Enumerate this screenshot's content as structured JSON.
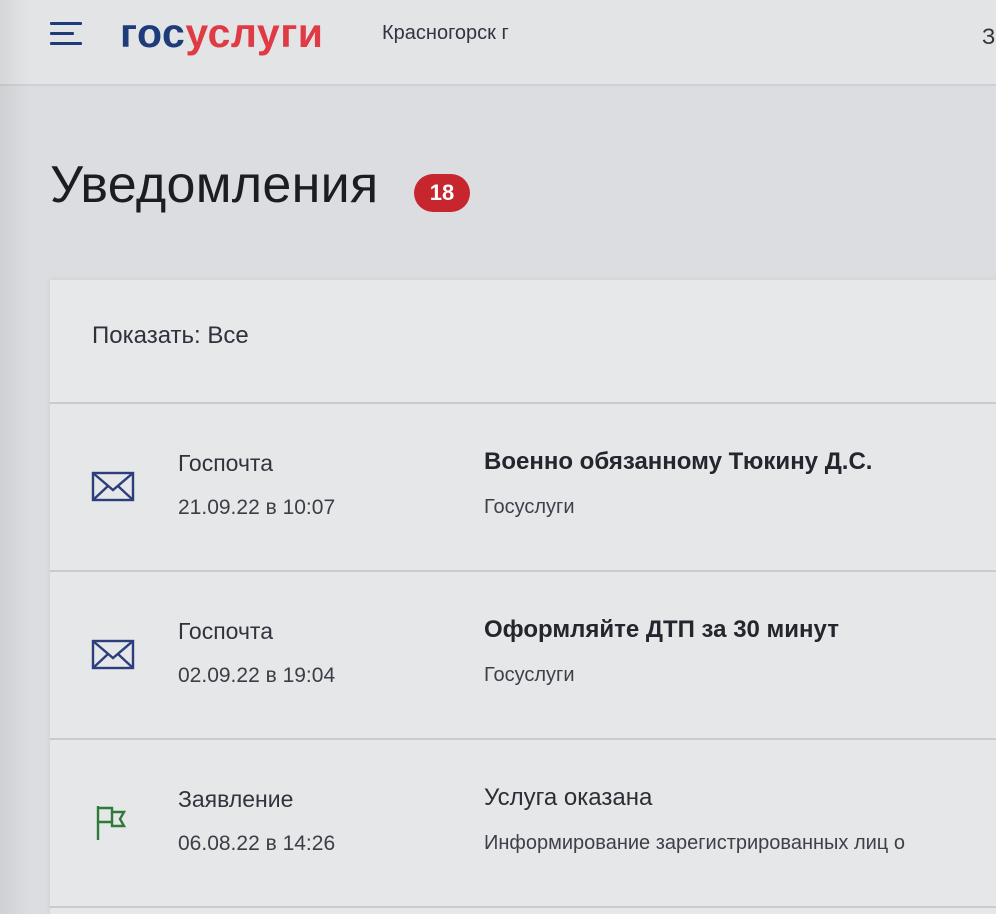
{
  "header": {
    "logo_part1": "гос",
    "logo_part2": "услуги",
    "location": "Красногорск г",
    "cut_text": "З"
  },
  "colors": {
    "brand_blue": "#1f3c7a",
    "brand_red": "#e03a44",
    "badge_red": "#c8262f",
    "mail_icon": "#2c3f7c",
    "flag_icon": "#2f7a3a"
  },
  "page": {
    "title": "Уведомления",
    "badge_count": "18"
  },
  "filter": {
    "label": "Показать: Все"
  },
  "notifications": [
    {
      "icon": "envelope-icon",
      "type": "Госпочта",
      "date": "21.09.22 в 10:07",
      "title": "Военно обязанному Тюкину Д.С.",
      "subtitle": "Госуслуги"
    },
    {
      "icon": "envelope-icon",
      "type": "Госпочта",
      "date": "02.09.22 в 19:04",
      "title": "Оформляйте ДТП за 30 минут",
      "subtitle": "Госуслуги"
    },
    {
      "icon": "flag-icon",
      "type": "Заявление",
      "date": "06.08.22 в 14:26",
      "title": "Услуга оказана",
      "subtitle": "Информирование зарегистрированных лиц о"
    }
  ]
}
